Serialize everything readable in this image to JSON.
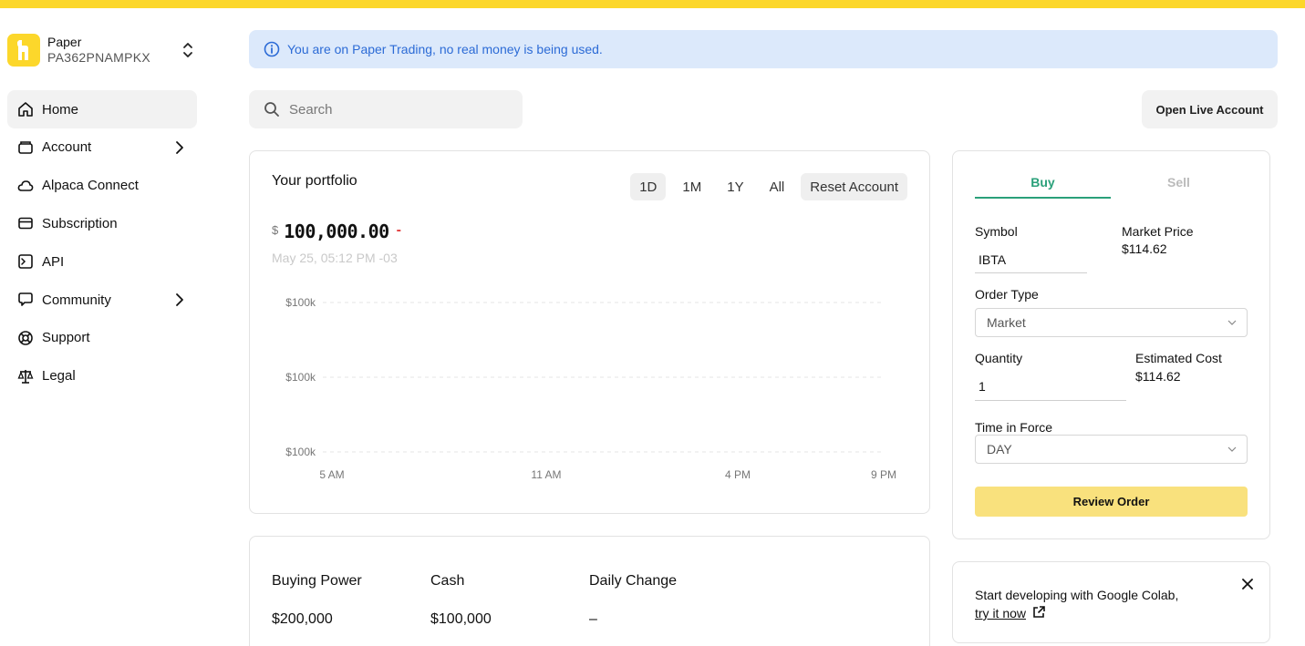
{
  "account": {
    "name": "Paper",
    "id": "PA362PNAMPKX"
  },
  "sidebar": {
    "items": [
      {
        "label": "Home",
        "icon": "home-icon"
      },
      {
        "label": "Account",
        "icon": "wallet-icon"
      },
      {
        "label": "Alpaca Connect",
        "icon": "cloud-icon"
      },
      {
        "label": "Subscription",
        "icon": "credit-card-icon"
      },
      {
        "label": "API",
        "icon": "terminal-icon"
      },
      {
        "label": "Community",
        "icon": "chat-icon"
      },
      {
        "label": "Support",
        "icon": "lifebuoy-icon"
      },
      {
        "label": "Legal",
        "icon": "scale-icon"
      }
    ]
  },
  "banner": {
    "text": "You are on Paper Trading, no real money is being used."
  },
  "search": {
    "placeholder": "Search"
  },
  "header": {
    "open_live_label": "Open Live Account"
  },
  "portfolio": {
    "title": "Your portfolio",
    "ranges": [
      "1D",
      "1M",
      "1Y",
      "All"
    ],
    "selected_range": "1D",
    "reset_label": "Reset Account",
    "currency": "$",
    "value": "100,000.00",
    "change": "-",
    "timestamp": "May 25, 05:12 PM -03"
  },
  "chart_data": {
    "type": "line",
    "title": "",
    "xlabel": "",
    "ylabel": "",
    "x_ticks": [
      "5 AM",
      "11 AM",
      "4 PM",
      "9 PM"
    ],
    "y_ticks": [
      "$100k",
      "$100k",
      "$100k"
    ],
    "series": [],
    "grid": true,
    "grid_color": "#e6e6e6"
  },
  "balances": {
    "buying_power_label": "Buying Power",
    "buying_power": "$200,000",
    "cash_label": "Cash",
    "cash": "$100,000",
    "daily_change_label": "Daily Change",
    "daily_change": "–"
  },
  "order": {
    "buy_label": "Buy",
    "sell_label": "Sell",
    "active_tab": "Buy",
    "symbol_label": "Symbol",
    "symbol_value": "IBTA",
    "market_price_label": "Market Price",
    "market_price": "$114.62",
    "order_type_label": "Order Type",
    "order_type": "Market",
    "quantity_label": "Quantity",
    "quantity": "1",
    "estimated_cost_label": "Estimated Cost",
    "estimated_cost": "$114.62",
    "time_in_force_label": "Time in Force",
    "time_in_force": "DAY",
    "review_label": "Review Order"
  },
  "colab": {
    "text": "Start developing with Google Colab,",
    "link": "try it now"
  },
  "colors": {
    "brand": "#fcd72b",
    "info_bg": "#dce9fb",
    "info_text": "#2c6bd6",
    "buy": "#2aa07a",
    "negative": "#e23d3d",
    "review_button": "#f9e17d"
  }
}
